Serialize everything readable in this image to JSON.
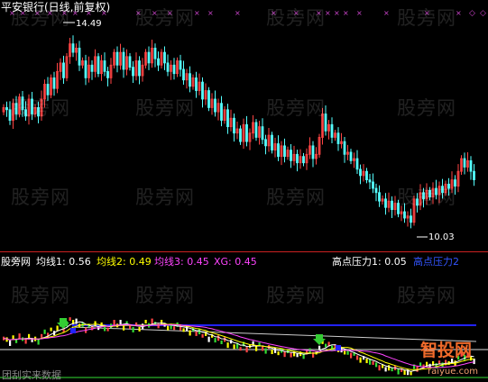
{
  "header": {
    "title": "平安银行(日线,前复权)"
  },
  "annotations": {
    "high": "14.49",
    "low": "10.03"
  },
  "indicator": {
    "prefix": "股旁网",
    "ma1": "均线1: 0.56",
    "ma2": "均线2: 0.49",
    "ma3": "均线3: 0.45",
    "xg": "XG: 0.45",
    "pressure": "高点压力1: 0.05",
    "pressure2": "高点压力2"
  },
  "watermarks": {
    "text": "股旁网",
    "bottom_left": "团刮实来数据",
    "site": "智投网",
    "site_url": "raiyue.com"
  },
  "colors": {
    "up": "#ff4444",
    "down": "#54ffff",
    "ma1": "#ffffff",
    "ma2": "#ffff00",
    "ma3": "#ff44ff",
    "blue": "#2222ff",
    "green": "#33dd33",
    "signal": "#33cc33",
    "marker": "#cc44cc"
  },
  "chart_data": [
    {
      "type": "candlestick",
      "title": "平安银行(日线,前复权)",
      "ylim": [
        9.6,
        14.9
      ],
      "annotations": [
        {
          "label": "14.49",
          "value": 14.49
        },
        {
          "label": "10.03",
          "value": 10.03
        }
      ],
      "closes": [
        12.75,
        12.7,
        12.45,
        12.85,
        12.6,
        13.0,
        12.7,
        12.55,
        12.95,
        12.6,
        12.75,
        12.55,
        12.95,
        13.3,
        13.05,
        13.45,
        13.2,
        13.6,
        13.8,
        13.45,
        13.95,
        14.25,
        14.05,
        14.15,
        13.75,
        13.85,
        13.45,
        13.75,
        13.6,
        13.95,
        13.55,
        13.85,
        13.6,
        13.45,
        13.75,
        14.05,
        13.75,
        14.05,
        13.65,
        13.95,
        13.7,
        13.5,
        13.85,
        13.5,
        13.75,
        14.05,
        13.8,
        14.15,
        13.9,
        13.75,
        14.05,
        13.8,
        13.6,
        13.75,
        13.55,
        13.85,
        13.65,
        13.4,
        13.55,
        13.25,
        13.45,
        13.15,
        13.35,
        12.95,
        13.15,
        12.75,
        12.95,
        12.65,
        12.85,
        12.45,
        12.7,
        12.3,
        12.5,
        12.15,
        12.25,
        11.95,
        12.35,
        11.95,
        12.15,
        12.4,
        12.05,
        12.3,
        12.0,
        11.85,
        12.1,
        11.75,
        11.9,
        11.6,
        11.85,
        11.6,
        11.75,
        11.5,
        11.65,
        11.45,
        11.6,
        11.45,
        11.65,
        11.85,
        11.55,
        11.65,
        12.05,
        12.6,
        12.2,
        12.35,
        12.05,
        12.15,
        11.9,
        11.95,
        11.65,
        11.7,
        11.5,
        11.55,
        11.3,
        11.15,
        11.25,
        11.05,
        11.0,
        10.85,
        10.75,
        10.55,
        10.6,
        10.4,
        10.55,
        10.35,
        10.5,
        10.25,
        10.3,
        10.15,
        10.2,
        10.05,
        10.6,
        10.45,
        10.75,
        10.6,
        10.8,
        10.65,
        10.85,
        10.7,
        10.9,
        10.75,
        10.95,
        10.85,
        11.05,
        10.9,
        11.25,
        11.55,
        11.35,
        11.5,
        11.25,
        11.05
      ],
      "series": [
        {
          "name": "高点压力1",
          "values": [
            0.05
          ]
        },
        {
          "name": "高点压力2",
          "values": []
        }
      ]
    },
    {
      "type": "line",
      "series": [
        {
          "name": "均线1",
          "values": [
            0.56
          ]
        },
        {
          "name": "均线2",
          "values": [
            0.49
          ]
        },
        {
          "name": "均线3",
          "values": [
            0.45
          ]
        },
        {
          "name": "XG",
          "values": [
            0.45
          ]
        }
      ]
    }
  ]
}
